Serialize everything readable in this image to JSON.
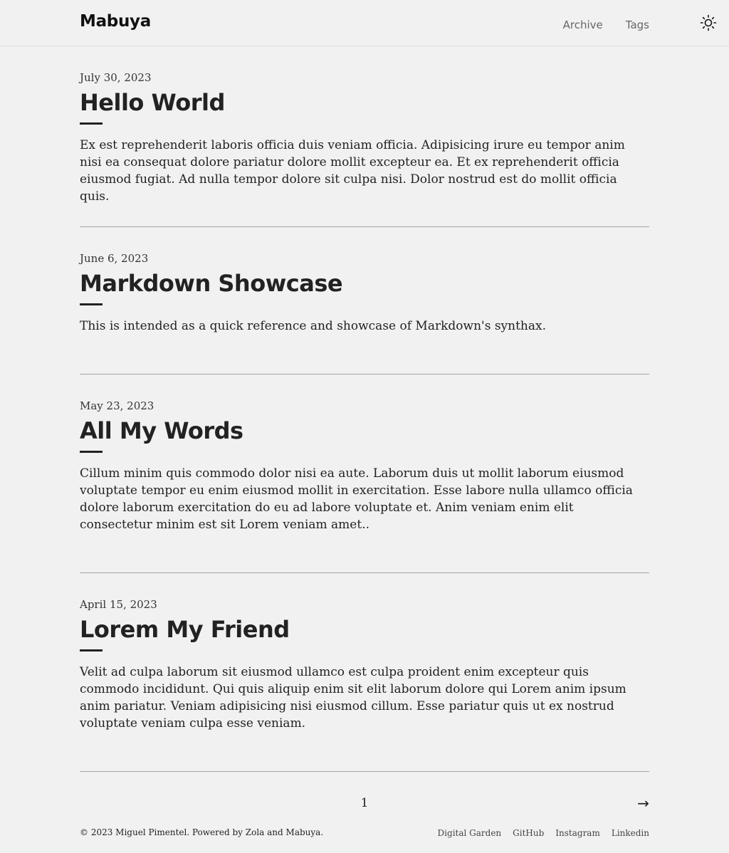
{
  "site": {
    "title": "Mabuya"
  },
  "nav": {
    "items": [
      {
        "label": "Archive"
      },
      {
        "label": "Tags"
      }
    ],
    "theme_toggle_icon": "sun-icon"
  },
  "posts": [
    {
      "date": "July 30, 2023",
      "title": "Hello World",
      "summary": "Ex est reprehenderit laboris officia duis veniam officia. Adipisicing irure eu tempor anim nisi ea consequat dolore pariatur dolore mollit excepteur ea. Et ex reprehenderit officia eiusmod fugiat. Ad nulla tempor dolore sit culpa nisi. Dolor nostrud est do mollit officia quis."
    },
    {
      "date": "June 6, 2023",
      "title": "Markdown Showcase",
      "summary": "This is intended as a quick reference and showcase of Markdown's synthax."
    },
    {
      "date": "May 23, 2023",
      "title": "All My Words",
      "summary": "Cillum minim quis commodo dolor nisi ea aute. Laborum duis ut mollit laborum eiusmod voluptate tempor eu enim eiusmod mollit in exercitation. Esse labore nulla ullamco officia dolore laborum exercitation do eu ad labore voluptate et. Anim veniam enim elit consectetur minim est sit Lorem veniam amet.."
    },
    {
      "date": "April 15, 2023",
      "title": "Lorem My Friend",
      "summary": "Velit ad culpa laborum sit eiusmod ullamco est culpa proident enim excepteur quis commodo incididunt. Qui quis aliquip enim sit elit laborum dolore qui Lorem anim ipsum anim pariatur. Veniam adipisicing nisi eiusmod cillum. Esse pariatur quis ut ex nostrud voluptate veniam culpa esse veniam."
    }
  ],
  "pagination": {
    "current_page": "1",
    "next_label": "→"
  },
  "footer": {
    "copyright": "© 2023 Miguel Pimentel. Powered by ",
    "powered_by_zola": "Zola",
    "and": " and ",
    "powered_by_mabuya": "Mabuya",
    "period": ".",
    "links": [
      {
        "label": "Digital Garden"
      },
      {
        "label": "GitHub"
      },
      {
        "label": "Instagram"
      },
      {
        "label": "Linkedin"
      }
    ]
  },
  "colors": {
    "background": "#f2f1f1",
    "text": "#222222",
    "nav_text": "#666666",
    "divider": "#a5a5a5"
  }
}
